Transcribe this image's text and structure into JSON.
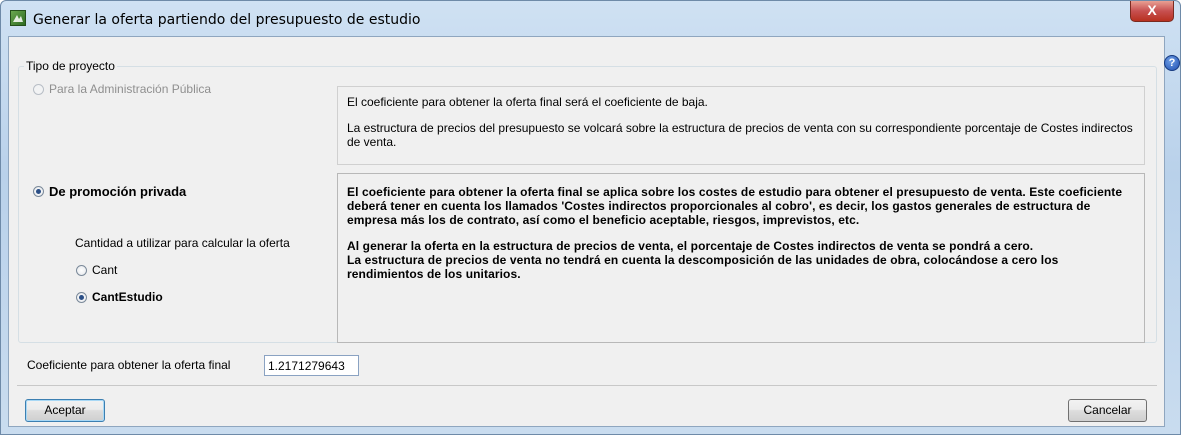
{
  "window": {
    "title": "Generar la oferta partiendo del presupuesto de estudio",
    "close_label": "X"
  },
  "help_label": "?",
  "group": {
    "title": "Tipo de proyecto",
    "option_admin": {
      "label": "Para la Administración Pública",
      "selected": false,
      "enabled": false
    },
    "admin_info": [
      "El coeficiente para obtener la oferta final será el coeficiente de baja.",
      "La estructura de precios del presupuesto se volcará sobre la estructura de precios de venta con su correspondiente porcentaje de Costes indirectos de venta."
    ],
    "option_private": {
      "label": "De promoción privada",
      "selected": true
    },
    "quantity_prompt": "Cantidad a utilizar para calcular la oferta",
    "quantity_options": [
      {
        "label": "Cant",
        "selected": false
      },
      {
        "label": "CantEstudio",
        "selected": true
      }
    ],
    "private_info": [
      "El coeficiente para obtener la oferta final se aplica sobre los costes de estudio para obtener el presupuesto de venta. Este coeficiente deberá tener en cuenta los llamados 'Costes indirectos proporcionales al cobro', es decir, los gastos generales de estructura de empresa más los de contrato, así como el beneficio aceptable, riesgos, imprevistos, etc.",
      "Al generar la oferta en la estructura de precios de venta, el porcentaje de Costes indirectos de venta se pondrá a cero.",
      "La estructura de precios de venta no tendrá en cuenta la descomposición de las unidades de obra, colocándose a cero los rendimientos de los unitarios."
    ]
  },
  "coefficient": {
    "label": "Coeficiente para obtener la oferta final",
    "value": "1.2171279643"
  },
  "buttons": {
    "accept": "Aceptar",
    "cancel": "Cancelar"
  },
  "colors": {
    "titlebar": "#b9d1ea",
    "close": "#c75050",
    "client_bg": "#f0f0f0"
  }
}
